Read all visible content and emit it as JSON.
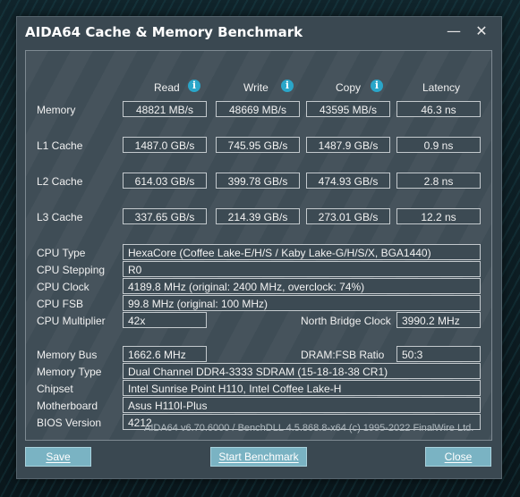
{
  "window": {
    "title": "AIDA64 Cache & Memory Benchmark",
    "minimize_glyph": "—",
    "close_glyph": "✕"
  },
  "columns": {
    "read": "Read",
    "write": "Write",
    "copy": "Copy",
    "latency": "Latency",
    "info_glyph": "i"
  },
  "rows": [
    {
      "label": "Memory",
      "read": "48821 MB/s",
      "write": "48669 MB/s",
      "copy": "43595 MB/s",
      "latency": "46.3 ns"
    },
    {
      "label": "L1 Cache",
      "read": "1487.0 GB/s",
      "write": "745.95 GB/s",
      "copy": "1487.9 GB/s",
      "latency": "0.9 ns"
    },
    {
      "label": "L2 Cache",
      "read": "614.03 GB/s",
      "write": "399.78 GB/s",
      "copy": "474.93 GB/s",
      "latency": "2.8 ns"
    },
    {
      "label": "L3 Cache",
      "read": "337.65 GB/s",
      "write": "214.39 GB/s",
      "copy": "273.01 GB/s",
      "latency": "12.2 ns"
    }
  ],
  "cpu": {
    "type_label": "CPU Type",
    "type": "HexaCore   (Coffee Lake-E/H/S / Kaby Lake-G/H/S/X, BGA1440)",
    "stepping_label": "CPU Stepping",
    "stepping": "R0",
    "clock_label": "CPU Clock",
    "clock": "4189.8 MHz  (original: 2400 MHz, overclock: 74%)",
    "fsb_label": "CPU FSB",
    "fsb": "99.8 MHz  (original: 100 MHz)",
    "multiplier_label": "CPU Multiplier",
    "multiplier": "42x",
    "nb_clock_label": "North Bridge Clock",
    "nb_clock": "3990.2 MHz"
  },
  "system": {
    "memory_bus_label": "Memory Bus",
    "memory_bus": "1662.6 MHz",
    "dram_ratio_label": "DRAM:FSB Ratio",
    "dram_ratio": "50:3",
    "memory_type_label": "Memory Type",
    "memory_type": "Dual Channel DDR4-3333 SDRAM  (15-18-18-38 CR1)",
    "chipset_label": "Chipset",
    "chipset": "Intel Sunrise Point H110, Intel Coffee Lake-H",
    "motherboard_label": "Motherboard",
    "motherboard": "Asus H110I-Plus",
    "bios_label": "BIOS Version",
    "bios": "4212"
  },
  "footer": "AIDA64 v6.70.6000 / BenchDLL 4.5.868.8-x64  (c) 1995-2022 FinalWire Ltd.",
  "buttons": {
    "save": "Save",
    "start": "Start Benchmark",
    "close": "Close"
  }
}
